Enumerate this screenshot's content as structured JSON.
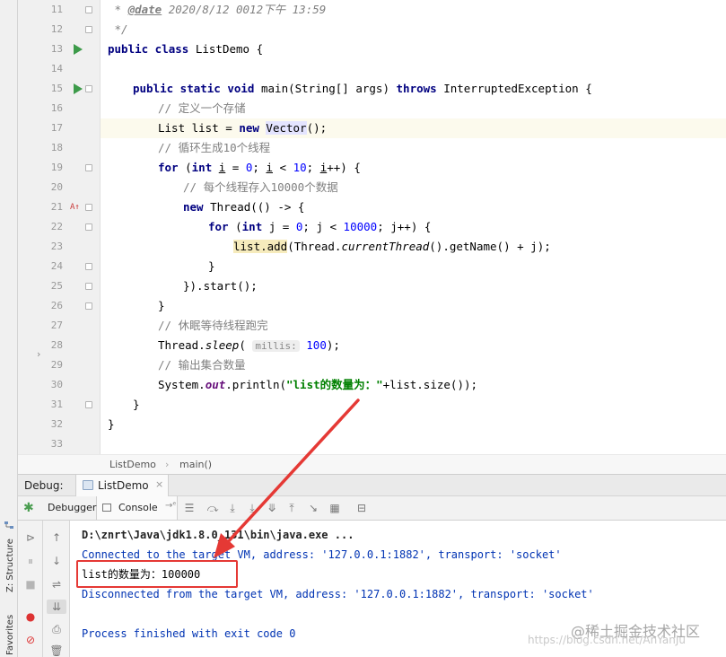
{
  "editor": {
    "lines": [
      {
        "num": "11",
        "fold": true
      },
      {
        "num": "12",
        "fold": true
      },
      {
        "num": "13",
        "run": true
      },
      {
        "num": "14"
      },
      {
        "num": "15",
        "run": true,
        "fold": true
      },
      {
        "num": "16"
      },
      {
        "num": "17"
      },
      {
        "num": "18"
      },
      {
        "num": "19",
        "fold": true
      },
      {
        "num": "20"
      },
      {
        "num": "21",
        "breakpoint": true,
        "fold": true
      },
      {
        "num": "22",
        "fold": true
      },
      {
        "num": "23"
      },
      {
        "num": "24",
        "fold": true
      },
      {
        "num": "25",
        "fold": true
      },
      {
        "num": "26",
        "fold": true
      },
      {
        "num": "27"
      },
      {
        "num": "28"
      },
      {
        "num": "29"
      },
      {
        "num": "30"
      },
      {
        "num": "31",
        "fold": true
      },
      {
        "num": "32"
      },
      {
        "num": "33"
      }
    ],
    "breakpoint_label": "A",
    "code": {
      "l11_tag": "@date",
      "l11_rest": " 2020/8/12 0012下午 13:59",
      "l12": "*/",
      "l13_kw": "public class",
      "l13_rest": " ListDemo {",
      "l15_kw1": "public static void",
      "l15_mid": " main(String[] args) ",
      "l15_kw2": "throws",
      "l15_rest": " InterruptedException {",
      "l16": "// 定义一个存储",
      "l17_a": "List list = ",
      "l17_kw": "new",
      "l17_sp": " ",
      "l17_vec": "Vector",
      "l17_b": "();",
      "l18": "// 循环生成10个线程",
      "l19_kw1": "for",
      "l19_a": " (",
      "l19_kw2": "int",
      "l19_sp": " ",
      "l19_i1": "i",
      "l19_b": " = ",
      "l19_n0": "0",
      "l19_c": "; ",
      "l19_i2": "i",
      "l19_d": " < ",
      "l19_n10": "10",
      "l19_e": "; ",
      "l19_i3": "i",
      "l19_f": "++) {",
      "l20": "// 每个线程存入10000个数据",
      "l21_kw": "new",
      "l21_rest": " Thread(() -> {",
      "l22_kw1": "for",
      "l22_a": " (",
      "l22_kw2": "int",
      "l22_b": " j = ",
      "l22_n0": "0",
      "l22_c": "; j < ",
      "l22_n": "10000",
      "l22_d": "; j++) {",
      "l23_var": "list.add",
      "l23_a": "(Thread.",
      "l23_static": "currentThread",
      "l23_b": "().getName() + j);",
      "l24": "}",
      "l25": "}).start();",
      "l26": "}",
      "l27": "// 休眠等待线程跑完",
      "l28_a": "Thread.",
      "l28_static": "sleep",
      "l28_b": "( ",
      "l28_hint": "millis:",
      "l28_sp": " ",
      "l28_n": "100",
      "l28_c": ");",
      "l29": "// 输出集合数量",
      "l30_a": "System.",
      "l30_field": "out",
      "l30_b": ".println(",
      "l30_str": "\"list的数量为：\"",
      "l30_c": "+list.size());",
      "l31": "}",
      "l32": "}"
    }
  },
  "breadcrumb": {
    "class": "ListDemo",
    "method": "main()"
  },
  "debug": {
    "label": "Debug:",
    "session_tab": "ListDemo",
    "tabs": {
      "debugger": "Debugger",
      "console": "Console"
    },
    "console_lines": {
      "cmd": "D:\\znrt\\Java\\jdk1.8.0_131\\bin\\java.exe ...",
      "connected": "Connected to the target VM, address: '127.0.0.1:1882', transport: 'socket'",
      "output": "list的数量为：100000",
      "disconnected": "Disconnected from the target VM, address: '127.0.0.1:1882', transport: 'socket'",
      "finished": "Process finished with exit code 0"
    }
  },
  "side_tabs": {
    "structure": "Z: Structure",
    "favorites": "Favorites"
  },
  "watermark": {
    "cn": "@稀土掘金技术社区",
    "url": "https://blog.csdn.net/AnYanJu"
  },
  "colors": {
    "annotation": "#e53935",
    "keyword": "#000080",
    "string": "#008000",
    "console_blue": "#0033b3"
  }
}
